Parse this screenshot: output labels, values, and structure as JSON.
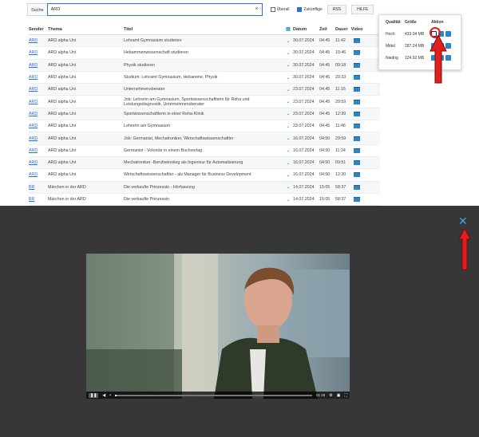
{
  "search": {
    "label": "Suche",
    "value": "ARD",
    "clear": "×"
  },
  "options": {
    "ueberall": "Überall",
    "zukuenftige": "Zukünftige",
    "rss": "RSS",
    "hilfe": "HILFE"
  },
  "table": {
    "headers": {
      "sender": "Sender",
      "thema": "Thema",
      "titel": "Titel",
      "datum": "Datum",
      "zeit": "Zeit",
      "dauer": "Dauer",
      "video": "Video"
    },
    "rows": [
      {
        "sender": "ARD",
        "thema": "ARD alpha Uni",
        "titel": "Lehramt Gymnasium studieren",
        "datum": "30.07.2024",
        "zeit": "04:45",
        "dauer": "11:42"
      },
      {
        "sender": "ARD",
        "thema": "ARD alpha Uni",
        "titel": "Hebammenwissenschaft studieren",
        "datum": "30.07.2024",
        "zeit": "04:45",
        "dauer": "10:46"
      },
      {
        "sender": "ARD",
        "thema": "ARD alpha Uni",
        "titel": "Physik studieren",
        "datum": "30.07.2024",
        "zeit": "04:45",
        "dauer": "09:18"
      },
      {
        "sender": "ARD",
        "thema": "ARD alpha Uni",
        "titel": "Studium: Lehramt Gymnasium, Hebamme, Physik",
        "datum": "30.07.2024",
        "zeit": "04:45",
        "dauer": "29:33"
      },
      {
        "sender": "ARD",
        "thema": "ARD alpha Uni",
        "titel": "Unternehmensberater",
        "datum": "23.07.2024",
        "zeit": "04:45",
        "dauer": "11:15"
      },
      {
        "sender": "ARD",
        "thema": "ARD alpha Uni",
        "titel": "Job: Lehrerin am Gymnasium, Sportwissenschaftlerin für Reha und Leistungsdiagnostik, Unternehmensberater",
        "datum": "23.07.2024",
        "zeit": "04:45",
        "dauer": "29:59"
      },
      {
        "sender": "ARD",
        "thema": "ARD alpha Uni",
        "titel": "Sportwissenschaftlerin in einer Reha-Klinik",
        "datum": "23.07.2024",
        "zeit": "04:45",
        "dauer": "12:39"
      },
      {
        "sender": "ARD",
        "thema": "ARD alpha Uni",
        "titel": "Lehrerin am Gymnasium",
        "datum": "23.07.2024",
        "zeit": "04:45",
        "dauer": "11:46"
      },
      {
        "sender": "ARD",
        "thema": "ARD alpha Uni",
        "titel": "Job: Germanist, Mechatroniker, Wirtschaftswissenschaftler",
        "datum": "16.07.2024",
        "zeit": "04:50",
        "dauer": "29:59"
      },
      {
        "sender": "ARD",
        "thema": "ARD alpha Uni",
        "titel": "Germanist - Volontär in einem Buchverlag",
        "datum": "16.07.2024",
        "zeit": "04:50",
        "dauer": "11:24"
      },
      {
        "sender": "ARD",
        "thema": "ARD alpha Uni",
        "titel": "Mechatroniker -Berufseinstieg als Ingenieur für Automatisierung",
        "datum": "16.07.2024",
        "zeit": "04:50",
        "dauer": "09:51"
      },
      {
        "sender": "ARD",
        "thema": "ARD alpha Uni",
        "titel": "Wirtschaftswissenschaftler - als Manager für Business Development",
        "datum": "16.07.2024",
        "zeit": "04:50",
        "dauer": "12:30"
      },
      {
        "sender": "BR",
        "thema": "Märchen in der ARD",
        "titel": "Die verkaufte Prinzessin - Hörfassung",
        "datum": "14.07.2024",
        "zeit": "15:05",
        "dauer": "58:37"
      },
      {
        "sender": "BR",
        "thema": "Märchen in der ARD",
        "titel": "Die verkaufte Prinzessin",
        "datum": "14.07.2024",
        "zeit": "15:05",
        "dauer": "58:37"
      }
    ]
  },
  "popup": {
    "headers": {
      "qualitaet": "Qualität",
      "groesse": "Größe",
      "aktion": "Aktion"
    },
    "rows": [
      {
        "q": "Hoch",
        "g": "433.04 MB"
      },
      {
        "q": "Mittel",
        "g": "287.24 MB"
      },
      {
        "q": "Niedrig",
        "g": "124.92 MB"
      }
    ]
  },
  "player": {
    "time": "01:28"
  },
  "colors": {
    "accent": "#2a86c9",
    "highlight": "#e02020",
    "close": "#4aa3e0"
  }
}
